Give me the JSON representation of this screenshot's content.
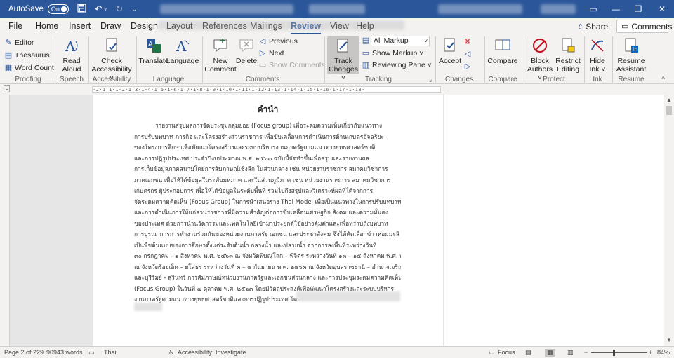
{
  "titlebar": {
    "autosave_label": "AutoSave",
    "autosave_state": "On",
    "icons": [
      "save-icon",
      "undo-icon",
      "redo-icon",
      "customize-icon"
    ]
  },
  "tabs": [
    "File",
    "Home",
    "Insert",
    "Draw",
    "Design",
    "Layout",
    "References",
    "Mailings",
    "Review",
    "View",
    "Help"
  ],
  "active_tab": "Review",
  "share_label": "Share",
  "comments_label": "Comments",
  "ribbon": {
    "proofing": {
      "label": "Proofing",
      "editor": "Editor",
      "thesaurus": "Thesaurus",
      "word_count": "Word Count"
    },
    "speech": {
      "label": "Speech",
      "read_aloud_1": "Read",
      "read_aloud_2": "Aloud"
    },
    "accessibility": {
      "label": "Accessibility",
      "check_1": "Check",
      "check_2": "Accessibility ˅"
    },
    "language": {
      "label": "Language",
      "translate": "Translate",
      "language": "Language"
    },
    "comments": {
      "label": "Comments",
      "new_1": "New",
      "new_2": "Comment",
      "delete": "Delete",
      "previous": "Previous",
      "next": "Next",
      "show_comments": "Show Comments"
    },
    "tracking": {
      "label": "Tracking",
      "track_1": "Track",
      "track_2": "Changes ˅",
      "all_markup": "All Markup",
      "show_markup": "Show Markup ˅",
      "reviewing_pane": "Reviewing Pane ˅"
    },
    "changes": {
      "label": "Changes",
      "accept": "Accept"
    },
    "compare": {
      "label": "Compare",
      "compare": "Compare"
    },
    "protect": {
      "label": "Protect",
      "block_1": "Block",
      "block_2": "Authors ˅",
      "restrict_1": "Restrict",
      "restrict_2": "Editing"
    },
    "ink": {
      "label": "Ink",
      "hide_1": "Hide",
      "hide_2": "Ink ˅"
    },
    "resume": {
      "label": "Resume",
      "resume_1": "Resume",
      "resume_2": "Assistant"
    }
  },
  "ruler_text": "·2·1·1·1·2·1·3·1·4·1·5·1·6·1·7·1·8·1·9·1·10·1·11·1·12·1·13·1·14·1·15·1·16·1·17·1·18·",
  "document": {
    "title": "คำนำ",
    "lines": [
      "รายงานสรุปผลการจัดประชุมกลุ่มย่อย (Focus group) เพื่อระดมความเห็นเกี่ยวกับแนวทาง",
      "การปรับบทบาท ภารกิจ และโครงสร้างส่วนราชการ เพื่อขับเคลื่อนการดำเนินการด้านเกษตรอัจฉริยะ",
      "ของโครงการศึกษาเพื่อพัฒนาโครงสร้างและระบบบริหารงานภาครัฐตามแนวทางยุทธศาสตร์ชาติ",
      "และการปฏิรูปประเทศ ประจำปีงบประมาณ พ.ศ. ๒๕๖๓ ฉบับนี้จัดทำขึ้นเพื่อสรุปและรายงานผล",
      "การเก็บข้อมูลภาคสนามโดยการสัมภาษณ์เชิงลึก ในส่วนกลาง เช่น หน่วยงานราชการ สมาคมวิชาการ",
      "ภาคเอกชน เพื่อให้ได้ข้อมูลในระดับมหภาค และในส่วนภูมิภาค เช่น หน่วยงานราชการ สมาคมวิชาการ",
      "เกษตรกร ผู้ประกอบการ เพื่อให้ได้ข้อมูลในระดับพื้นที่ รวมไปถึงสรุปและวิเคราะห์ผลที่ได้จากการ",
      "จัดระดมความคิดเห็น (Focus Group) ในการนำเสนอร่าง Thai Model เพื่อเป็นแนวทางในการปรับบทบาท",
      "และการดำเนินการให้แก่ส่วนราชการที่มีความสำคัญต่อการขับเคลื่อนเศรษฐกิจ สังคม และความมั่นคง",
      "ของประเทศ ด้วยการนำนวัตกรรมและเทคโนโลยีเข้ามาประยุกต์ใช้อย่างคุ้มค่าและเพื่อทราบถึงบทบาท",
      "การบูรณาการการทำงานร่วมกันของหน่วยงานภาครัฐ เอกชน และประชาสังคม ซึ่งได้คัดเลือกข้าวหอมมะลิ",
      "เป็นพืชต้นแบบของการศึกษาตั้งแต่ระดับต้นน้ำ กลางน้ำ และปลายน้ำ จากการลงพื้นที่ระหว่างวันที่",
      "๓๐ กรกฎาคม - ๑ สิงหาคม พ.ศ. ๒๕๖๓ ณ จังหวัดพิษณุโลก – พิจิตร ระหว่างวันที่ ๑๓ – ๑๕ สิงหาคม พ.ศ. ๒๕๖๓",
      "ณ จังหวัดร้อยเอ็ด – ยโสธร ระหว่างวันที่ ๓ – ๔ กันยายน พ.ศ. ๒๕๖๓ ณ จังหวัดอุบลราชธานี – อำนาจเจริญ",
      "และบุรีรัมย์ - สุรินทร์ การสัมภาษณ์หน่วยงานภาครัฐและเอกชนส่วนกลาง และการประชุมระดมความคิดเห็น",
      "(Focus Group) ในวันที่ ๗ ตุลาคม พ.ศ. ๒๕๖๓ โดยมีวัตถุประสงค์เพื่อพัฒนาโครงสร้างและระบบบริหาร",
      "งานภาครัฐตามแนวทางยุทธศาสตร์ชาติและการปฏิรูปประเทศ โดย"
    ]
  },
  "status": {
    "page": "Page 2 of 229",
    "words": "90943 words",
    "language": "Thai",
    "accessibility": "Accessibility: Investigate",
    "focus": "Focus",
    "zoom": "84%",
    "zoom_minus": "−",
    "zoom_plus": "+"
  }
}
